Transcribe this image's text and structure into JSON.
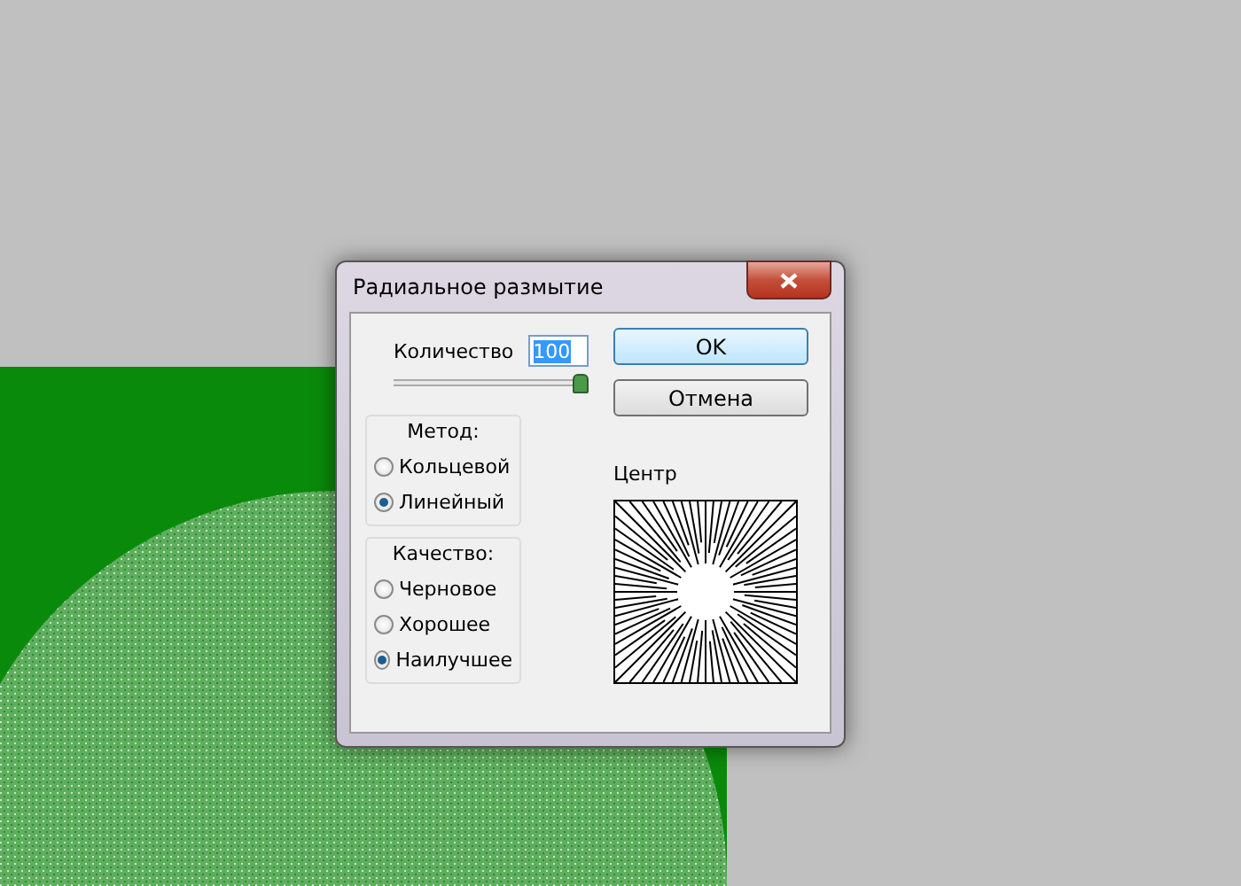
{
  "window": {
    "title": "Радиальное размытие"
  },
  "amount": {
    "label": "Количество",
    "value": "100",
    "level": 1
  },
  "buttons": [
    {
      "label": "OK",
      "default": true
    },
    {
      "label": "Отмена",
      "default": false
    }
  ],
  "method": {
    "title": "Метод:",
    "options": [
      {
        "label": "Кольцевой",
        "selected": false
      },
      {
        "label": "Линейный",
        "selected": true
      }
    ]
  },
  "quality": {
    "title": "Качество:",
    "options": [
      {
        "label": "Черновое",
        "selected": false
      },
      {
        "label": "Хорошее",
        "selected": false
      },
      {
        "label": "Наилучшее",
        "selected": true
      }
    ]
  },
  "center": {
    "label": "Центр"
  }
}
